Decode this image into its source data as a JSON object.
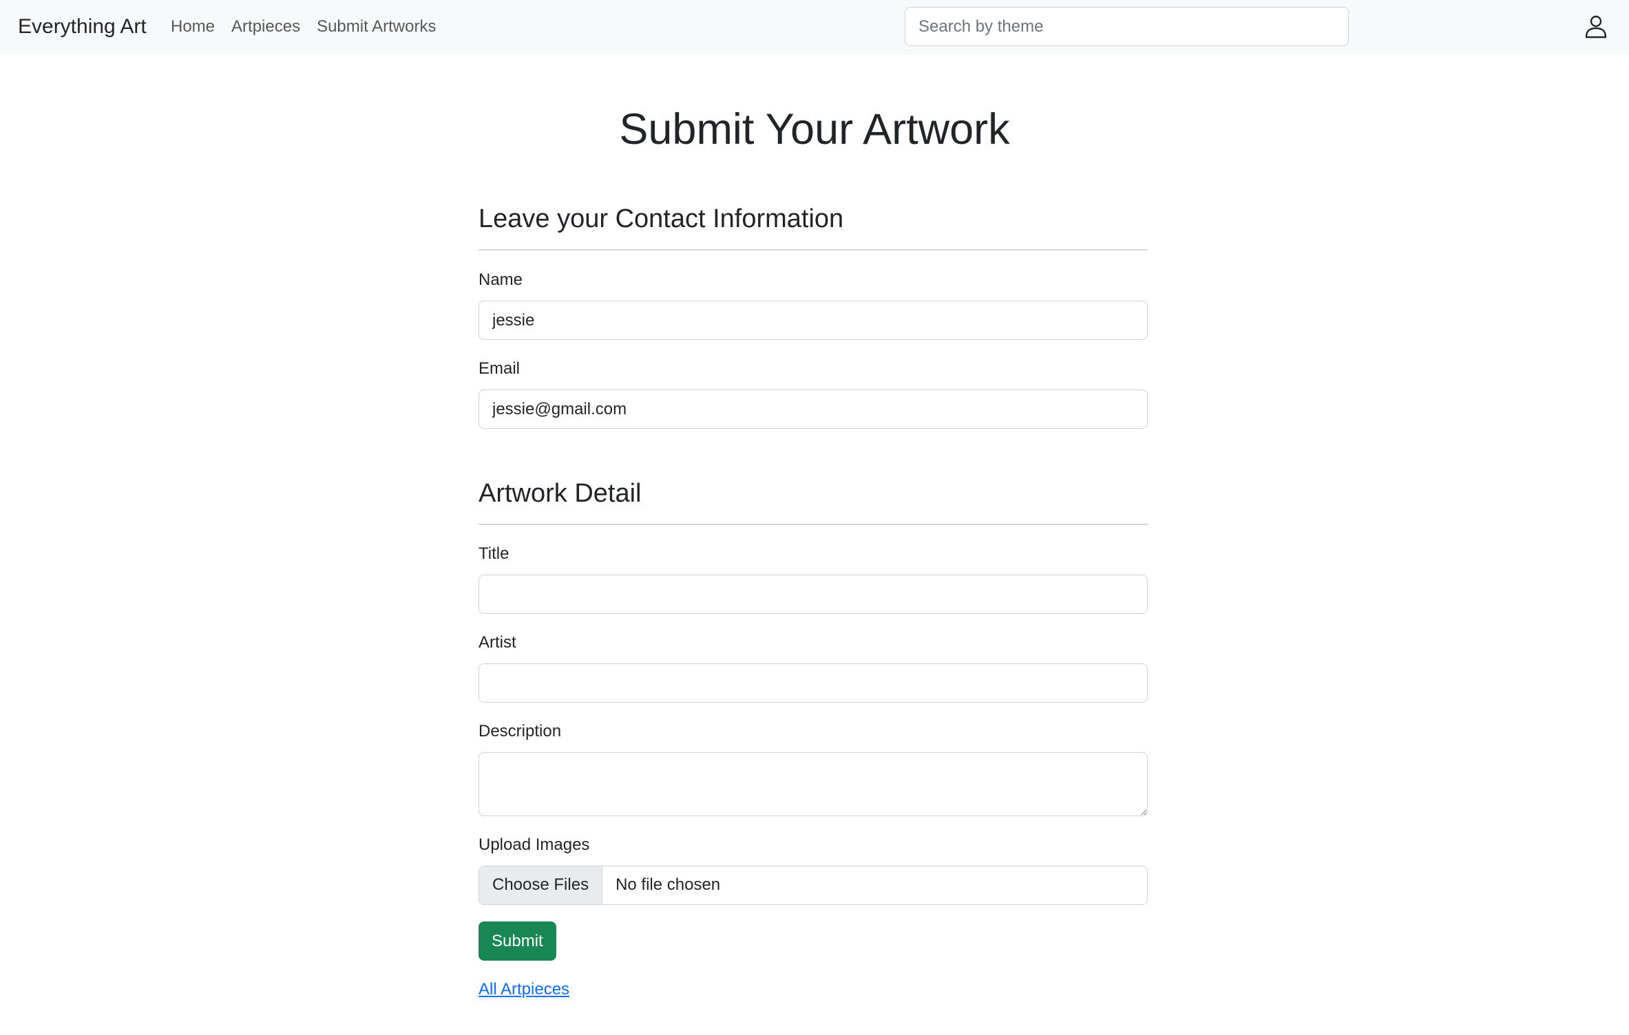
{
  "navbar": {
    "brand": "Everything Art",
    "links": [
      {
        "label": "Home"
      },
      {
        "label": "Artpieces"
      },
      {
        "label": "Submit Artworks"
      }
    ],
    "search_placeholder": "Search by theme",
    "user_icon": "user-icon"
  },
  "page": {
    "title": "Submit Your Artwork"
  },
  "contact_section": {
    "heading": "Leave your Contact Information",
    "name_label": "Name",
    "name_value": "jessie",
    "email_label": "Email",
    "email_value": "jessie@gmail.com"
  },
  "artwork_section": {
    "heading": "Artwork Detail",
    "title_label": "Title",
    "title_value": "",
    "artist_label": "Artist",
    "artist_value": "",
    "description_label": "Description",
    "description_value": "",
    "upload_label": "Upload Images",
    "choose_files_label": "Choose Files",
    "file_status": "No file chosen"
  },
  "actions": {
    "submit_label": "Submit",
    "all_artpieces_link": "All Artpieces"
  },
  "colors": {
    "navbar_bg": "#f8f9fa",
    "submit_green": "#198754",
    "link_blue": "#0d6efd"
  }
}
